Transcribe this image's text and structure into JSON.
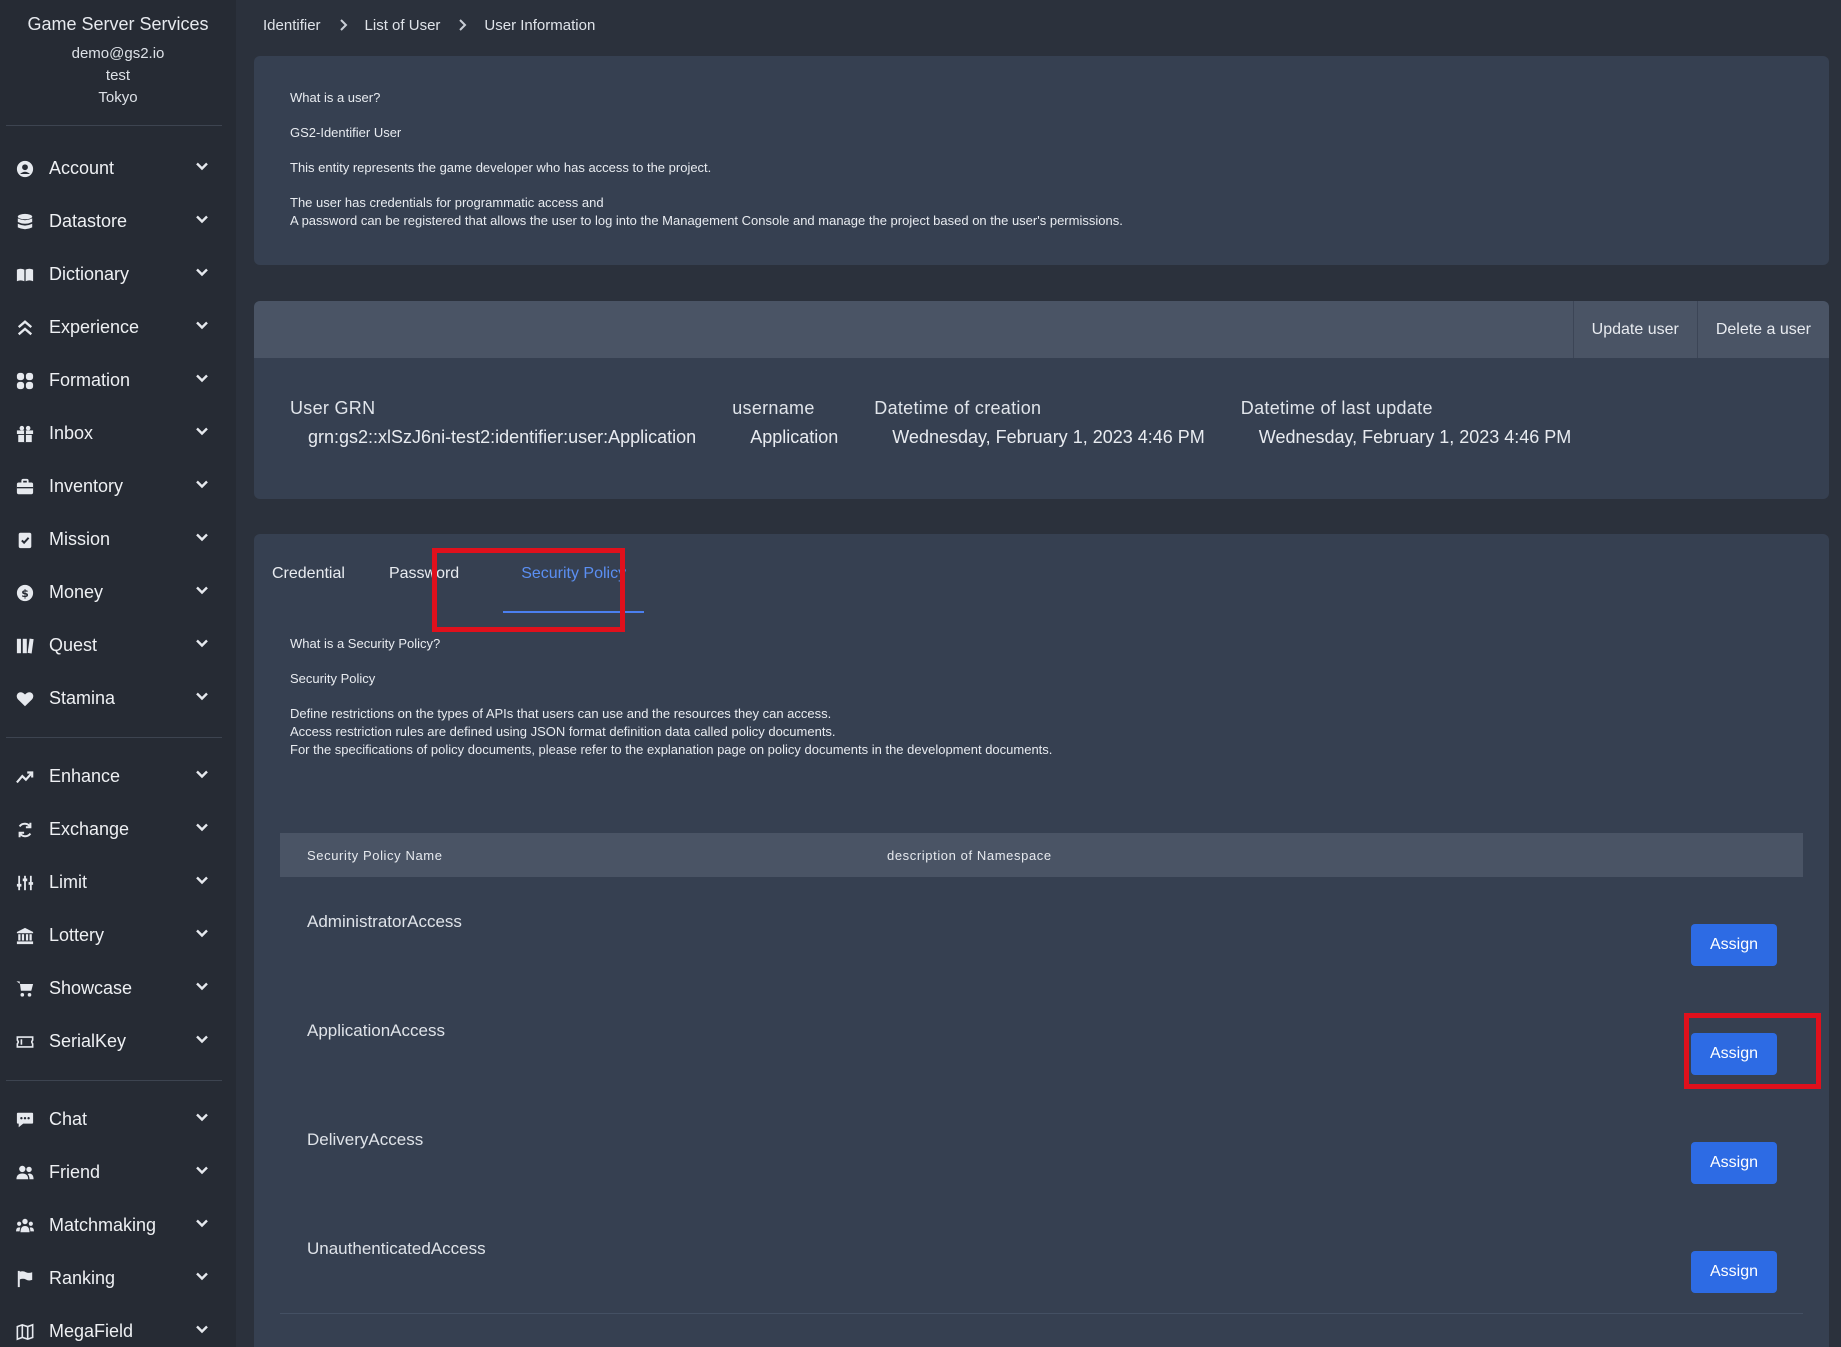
{
  "sidebar": {
    "title": "Game Server Services",
    "email": "demo@gs2.io",
    "project": "test",
    "region": "Tokyo",
    "groups": [
      [
        {
          "label": "Account",
          "icon": "user-circle-icon"
        },
        {
          "label": "Datastore",
          "icon": "database-icon"
        },
        {
          "label": "Dictionary",
          "icon": "book-icon"
        },
        {
          "label": "Experience",
          "icon": "double-chevron-up-icon"
        },
        {
          "label": "Formation",
          "icon": "grid-icon"
        },
        {
          "label": "Inbox",
          "icon": "gift-icon"
        },
        {
          "label": "Inventory",
          "icon": "briefcase-icon"
        },
        {
          "label": "Mission",
          "icon": "clipboard-check-icon"
        },
        {
          "label": "Money",
          "icon": "dollar-coin-icon"
        },
        {
          "label": "Quest",
          "icon": "map-book-icon"
        },
        {
          "label": "Stamina",
          "icon": "heart-icon"
        }
      ],
      [
        {
          "label": "Enhance",
          "icon": "trend-up-icon"
        },
        {
          "label": "Exchange",
          "icon": "exchange-icon"
        },
        {
          "label": "Limit",
          "icon": "sliders-icon"
        },
        {
          "label": "Lottery",
          "icon": "bank-icon"
        },
        {
          "label": "Showcase",
          "icon": "cart-icon"
        },
        {
          "label": "SerialKey",
          "icon": "ticket-icon"
        }
      ],
      [
        {
          "label": "Chat",
          "icon": "chat-icon"
        },
        {
          "label": "Friend",
          "icon": "users-icon"
        },
        {
          "label": "Matchmaking",
          "icon": "team-icon"
        },
        {
          "label": "Ranking",
          "icon": "flag-icon"
        },
        {
          "label": "MegaField",
          "icon": "map-icon"
        }
      ]
    ]
  },
  "breadcrumb": [
    "Identifier",
    "List of User",
    "User Information"
  ],
  "intro": {
    "heading": "What is a user?",
    "subheading": "GS2-Identifier User",
    "line1": "This entity represents the game developer who has access to the project.",
    "line2": "The user has credentials for programmatic access and",
    "line3": "A password can be registered that allows the user to log into the Management Console and manage the project based on the user's permissions."
  },
  "user": {
    "update_label": "Update user",
    "delete_label": "Delete a user",
    "fields": [
      {
        "label": "User GRN",
        "value": "grn:gs2::xlSzJ6ni-test2:identifier:user:Application"
      },
      {
        "label": "username",
        "value": "Application"
      },
      {
        "label": "Datetime of creation",
        "value": "Wednesday, February 1, 2023 4:46 PM"
      },
      {
        "label": "Datetime of last update",
        "value": "Wednesday, February 1, 2023 4:46 PM"
      }
    ]
  },
  "tabs": {
    "credential": "Credential",
    "password": "Password",
    "security_policy": "Security Policy",
    "active": "Security Policy"
  },
  "policy_info": {
    "heading": "What is a Security Policy?",
    "subheading": "Security Policy",
    "line1": "Define restrictions on the types of APIs that users can use and the resources they can access.",
    "line2": "Access restriction rules are defined using JSON format definition data called policy documents.",
    "line3": "For the specifications of policy documents, please refer to the explanation page on policy documents in the development documents."
  },
  "policy_table": {
    "columns": [
      "Security Policy Name",
      "description of Namespace"
    ],
    "rows": [
      {
        "name": "AdministratorAccess",
        "action": "Assign"
      },
      {
        "name": "ApplicationAccess",
        "action": "Assign"
      },
      {
        "name": "DeliveryAccess",
        "action": "Assign"
      },
      {
        "name": "UnauthenticatedAccess",
        "action": "Assign"
      }
    ]
  },
  "colors": {
    "accent": "#2d6be4",
    "highlight": "#e0101c",
    "active_tab": "#5b8ff3"
  }
}
